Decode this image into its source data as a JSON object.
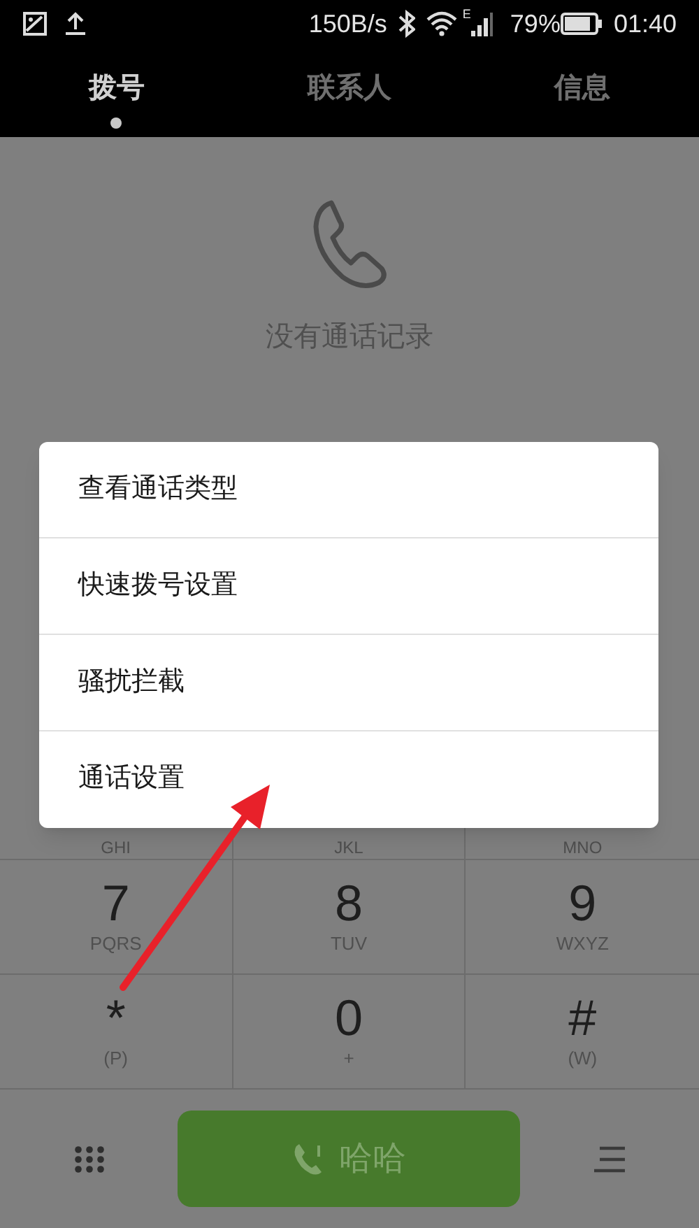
{
  "status_bar": {
    "speed": "150B/s",
    "network_type": "E",
    "battery": "79%",
    "time": "01:40"
  },
  "tabs": [
    {
      "label": "拨号",
      "selected": true
    },
    {
      "label": "联系人",
      "selected": false
    },
    {
      "label": "信息",
      "selected": false
    }
  ],
  "empty_state": {
    "message": "没有通话记录"
  },
  "menu": {
    "items": [
      {
        "label": "查看通话类型"
      },
      {
        "label": "快速拨号设置"
      },
      {
        "label": "骚扰拦截"
      },
      {
        "label": "通话设置"
      }
    ]
  },
  "keypad": {
    "partial_row": [
      "GHI",
      "JKL",
      "MNO"
    ],
    "rows": [
      [
        {
          "digit": "7",
          "letters": "PQRS"
        },
        {
          "digit": "8",
          "letters": "TUV"
        },
        {
          "digit": "9",
          "letters": "WXYZ"
        }
      ],
      [
        {
          "digit": "*",
          "letters": "(P)"
        },
        {
          "digit": "0",
          "letters": "+"
        },
        {
          "digit": "#",
          "letters": "(W)"
        }
      ]
    ]
  },
  "call_button": {
    "label": "哈哈"
  }
}
